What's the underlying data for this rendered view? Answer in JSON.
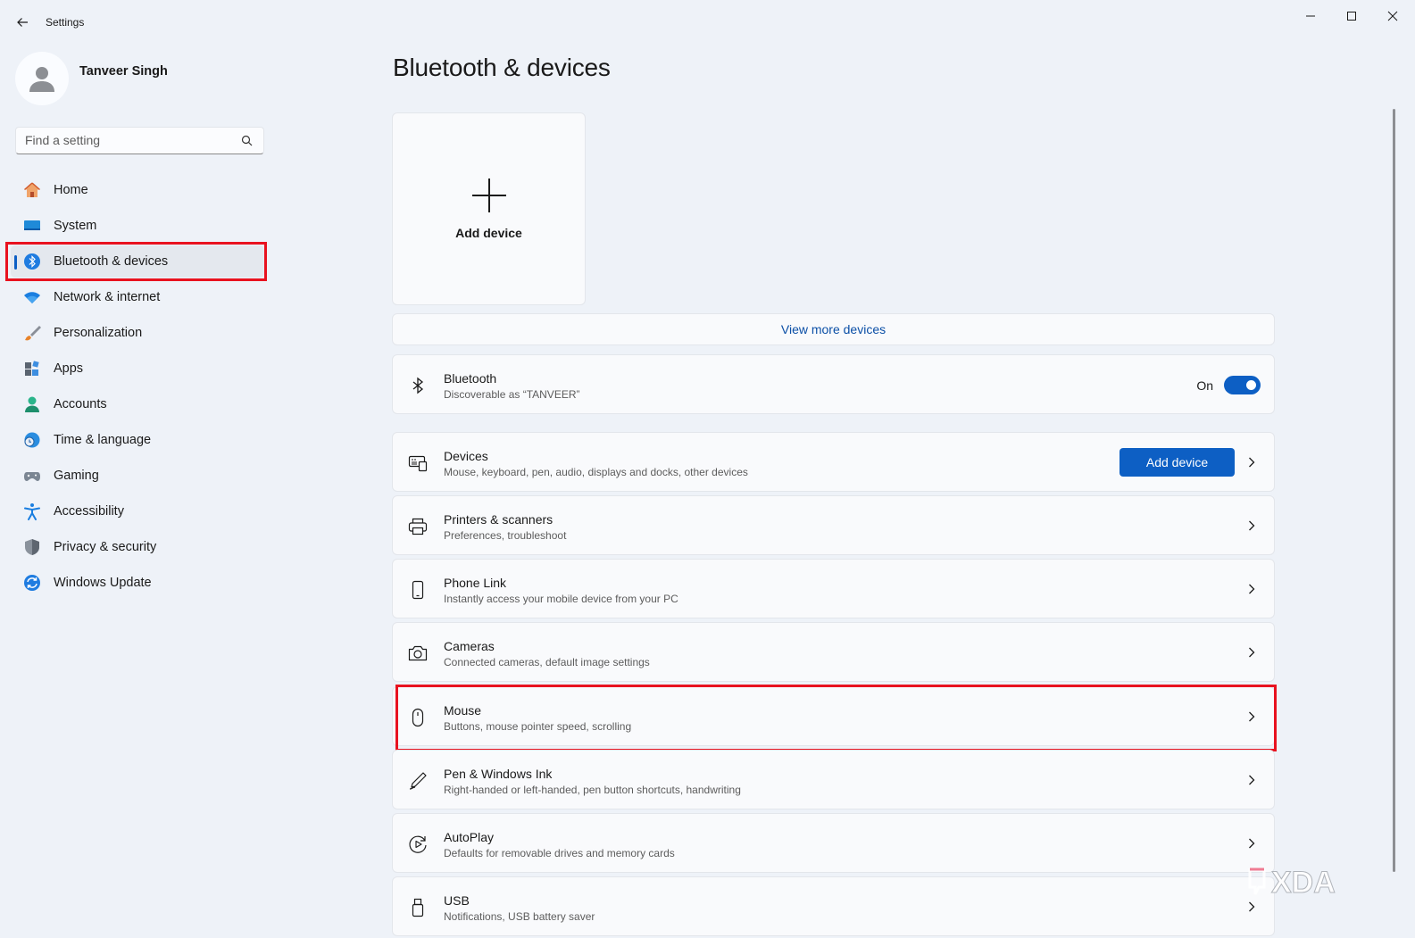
{
  "window": {
    "title": "Settings"
  },
  "profile": {
    "name": "Tanveer Singh"
  },
  "search": {
    "placeholder": "Find a setting"
  },
  "sidebar": {
    "items": [
      {
        "label": "Home",
        "icon": "home-icon"
      },
      {
        "label": "System",
        "icon": "system-icon"
      },
      {
        "label": "Bluetooth & devices",
        "icon": "bluetooth-icon",
        "active": true
      },
      {
        "label": "Network & internet",
        "icon": "wifi-icon"
      },
      {
        "label": "Personalization",
        "icon": "brush-icon"
      },
      {
        "label": "Apps",
        "icon": "apps-icon"
      },
      {
        "label": "Accounts",
        "icon": "accounts-icon"
      },
      {
        "label": "Time & language",
        "icon": "time-language-icon"
      },
      {
        "label": "Gaming",
        "icon": "gamepad-icon"
      },
      {
        "label": "Accessibility",
        "icon": "accessibility-icon"
      },
      {
        "label": "Privacy & security",
        "icon": "shield-icon"
      },
      {
        "label": "Windows Update",
        "icon": "update-icon"
      }
    ]
  },
  "main": {
    "title": "Bluetooth & devices",
    "add_tile_label": "Add device",
    "view_more": "View more devices",
    "bluetooth": {
      "title": "Bluetooth",
      "subtitle": "Discoverable as “TANVEER”",
      "toggle_label": "On"
    },
    "rows": [
      {
        "title": "Devices",
        "subtitle": "Mouse, keyboard, pen, audio, displays and docks, other devices",
        "button": "Add device",
        "icon": "devices-icon"
      },
      {
        "title": "Printers & scanners",
        "subtitle": "Preferences, troubleshoot",
        "icon": "printer-icon"
      },
      {
        "title": "Phone Link",
        "subtitle": "Instantly access your mobile device from your PC",
        "icon": "phone-icon"
      },
      {
        "title": "Cameras",
        "subtitle": "Connected cameras, default image settings",
        "icon": "camera-icon"
      },
      {
        "title": "Mouse",
        "subtitle": "Buttons, mouse pointer speed, scrolling",
        "icon": "mouse-icon"
      },
      {
        "title": "Pen & Windows Ink",
        "subtitle": "Right-handed or left-handed, pen button shortcuts, handwriting",
        "icon": "pen-icon"
      },
      {
        "title": "AutoPlay",
        "subtitle": "Defaults for removable drives and memory cards",
        "icon": "autoplay-icon"
      },
      {
        "title": "USB",
        "subtitle": "Notifications, USB battery saver",
        "icon": "usb-icon"
      }
    ]
  },
  "colors": {
    "accent": "#0d5fc4",
    "highlight": "#e8121f",
    "background": "#eef2f8"
  },
  "watermark": {
    "text": "XDA"
  }
}
